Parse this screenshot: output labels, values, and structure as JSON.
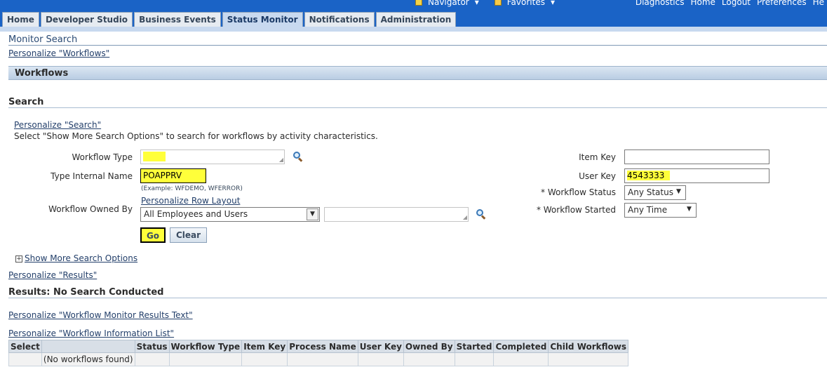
{
  "top_nav": {
    "navigator": "Navigator",
    "favorites": "Favorites"
  },
  "global_links": [
    "Diagnostics",
    "Home",
    "Logout",
    "Preferences",
    "He"
  ],
  "tabs": [
    {
      "label": "Home",
      "active": false
    },
    {
      "label": "Developer Studio",
      "active": false
    },
    {
      "label": "Business Events",
      "active": false
    },
    {
      "label": "Status Monitor",
      "active": true
    },
    {
      "label": "Notifications",
      "active": false
    },
    {
      "label": "Administration",
      "active": false
    }
  ],
  "page_title": "Monitor Search",
  "personalize_workflows": "Personalize \"Workflows\"",
  "section_header": "Workflows",
  "search": {
    "heading": "Search",
    "personalize": "Personalize \"Search\"",
    "instructions": "Select \"Show More Search Options\" to search for workflows by activity characteristics.",
    "workflow_type_label": "Workflow Type",
    "workflow_type_value": "",
    "type_internal_name_label": "Type Internal Name",
    "type_internal_name_value": "POAPPRV",
    "example_hint": "(Example: WFDEMO, WFERROR)",
    "personalize_row_layout": "Personalize Row Layout",
    "owned_by_label": "Workflow Owned By",
    "owned_by_value": "All Employees and Users",
    "owned_by_text": "",
    "go_button": "Go",
    "clear_button": "Clear",
    "item_key_label": "Item Key",
    "item_key_value": "",
    "user_key_label": "User Key",
    "user_key_value": "4543333",
    "status_label": "Workflow Status",
    "status_value": "Any Status",
    "started_label": "Workflow Started",
    "started_value": "Any Time",
    "required_mark": "*",
    "show_more": "Show More Search Options"
  },
  "personalize_results": "Personalize \"Results\"",
  "results_heading": "Results: No Search Conducted",
  "personalize_results_text": "Personalize \"Workflow Monitor Results Text\"",
  "personalize_info_list": "Personalize \"Workflow Information List\"",
  "results_table": {
    "columns": [
      "Select",
      "Status",
      "Workflow Type",
      "Item Key",
      "Process Name",
      "User Key",
      "Owned By",
      "Started",
      "Completed",
      "Child Workflows"
    ],
    "empty_message": "(No workflows found)"
  },
  "colors": {
    "banner": "#1a63c6",
    "highlight": "#ffff3a",
    "link": "#24406b"
  }
}
